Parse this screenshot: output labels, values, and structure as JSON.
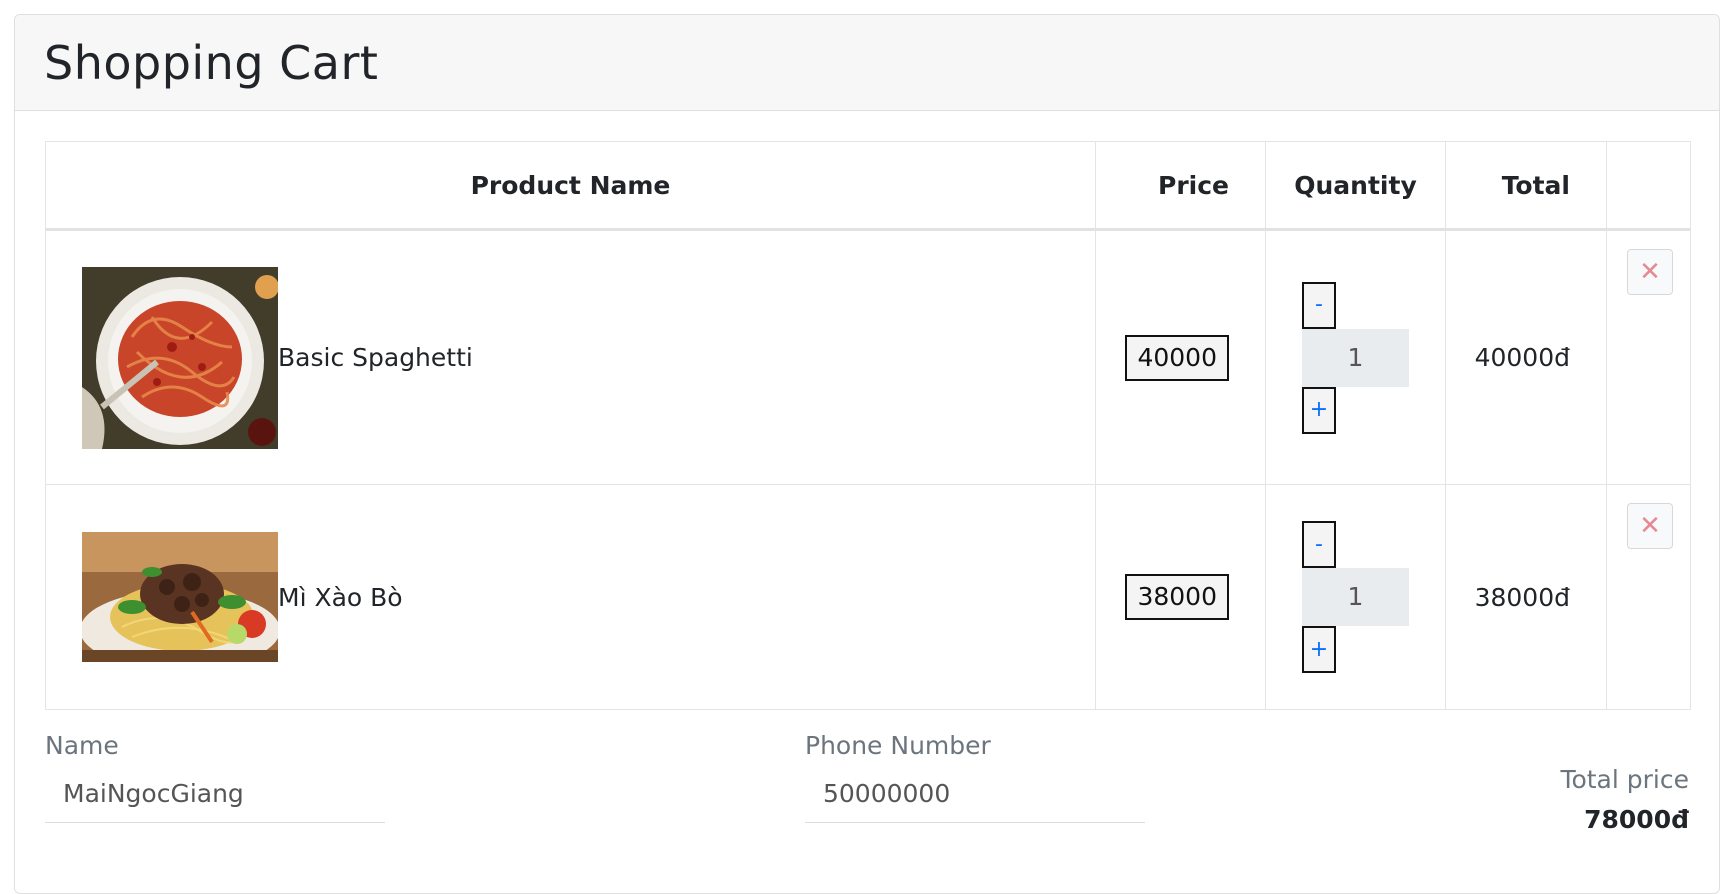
{
  "card": {
    "title": "Shopping Cart"
  },
  "table": {
    "headers": [
      "Product Name",
      "Price",
      "Quantity",
      "Total",
      ""
    ],
    "rows": [
      {
        "name": "Basic Spaghetti",
        "price": "40000",
        "minus": "-",
        "quantity": "1",
        "plus": "+",
        "total": "40000đ",
        "delete": "✕",
        "image": "spaghetti-photo"
      },
      {
        "name": "Mì Xào Bò",
        "price": "38000",
        "minus": "-",
        "quantity": "1",
        "plus": "+",
        "total": "38000đ",
        "delete": "✕",
        "image": "stir-fried-noodles-beef-photo"
      }
    ]
  },
  "form": {
    "name_label": "Name",
    "name_value": "MaiNgocGiang",
    "phone_label": "Phone Number",
    "phone_value": "50000000"
  },
  "summary": {
    "total_label": "Total price",
    "total_value": "78000đ"
  },
  "colors": {
    "accent": "#0d6efd",
    "delete": "#e58a94",
    "header_bg": "#f7f7f7"
  }
}
